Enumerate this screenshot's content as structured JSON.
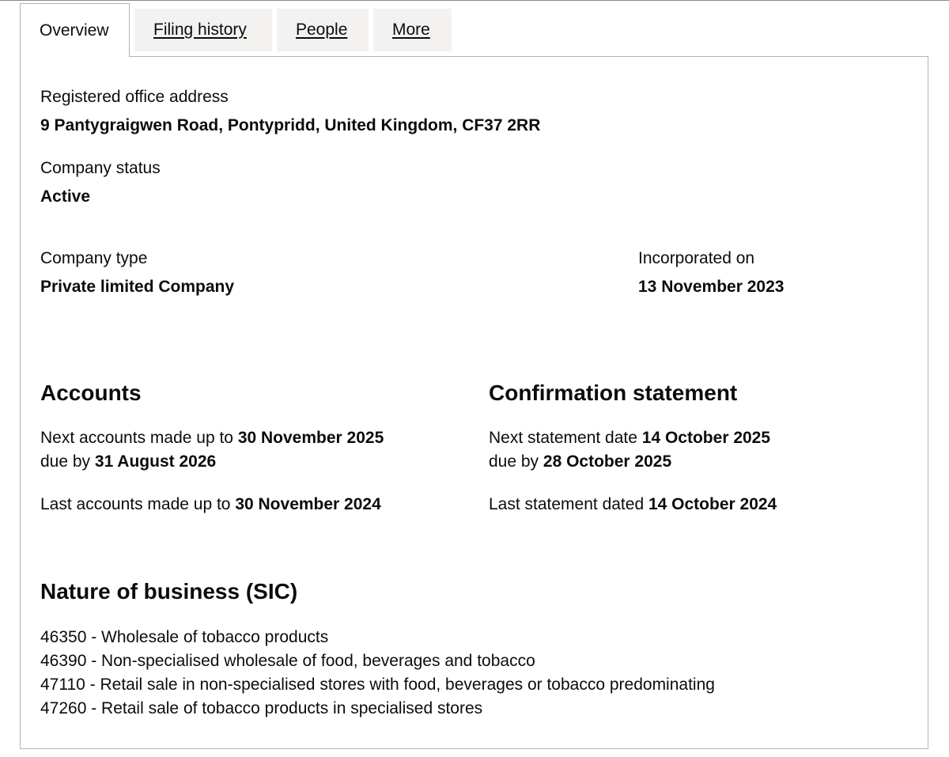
{
  "tabs": [
    {
      "label": "Overview",
      "active": true
    },
    {
      "label": "Filing history",
      "active": false
    },
    {
      "label": "People",
      "active": false
    },
    {
      "label": "More",
      "active": false
    }
  ],
  "overview": {
    "address_label": "Registered office address",
    "address_value": "9 Pantygraigwen Road, Pontypridd, United Kingdom, CF37 2RR",
    "status_label": "Company status",
    "status_value": "Active",
    "type_label": "Company type",
    "type_value": "Private limited Company",
    "incorporated_label": "Incorporated on",
    "incorporated_value": "13 November 2023"
  },
  "accounts": {
    "heading": "Accounts",
    "next_prefix": "Next accounts made up to ",
    "next_date": "30 November 2025",
    "due_prefix": "due by ",
    "due_date": "31 August 2026",
    "last_prefix": "Last accounts made up to ",
    "last_date": "30 November 2024"
  },
  "confirmation": {
    "heading": "Confirmation statement",
    "next_prefix": "Next statement date ",
    "next_date": "14 October 2025",
    "due_prefix": "due by ",
    "due_date": "28 October 2025",
    "last_prefix": "Last statement dated ",
    "last_date": "14 October 2024"
  },
  "sic": {
    "heading": "Nature of business (SIC)",
    "items": [
      "46350 - Wholesale of tobacco products",
      "46390 - Non-specialised wholesale of food, beverages and tobacco",
      "47110 - Retail sale in non-specialised stores with food, beverages or tobacco predominating",
      "47260 - Retail sale of tobacco products in specialised stores"
    ]
  }
}
